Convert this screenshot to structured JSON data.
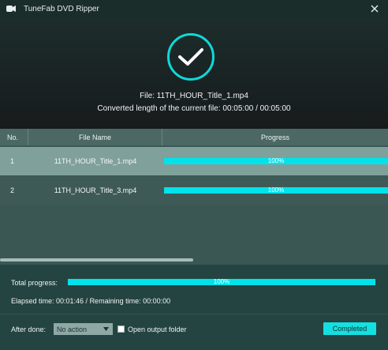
{
  "window": {
    "title": "TuneFab DVD Ripper"
  },
  "header": {
    "file_line": "File: 11TH_HOUR_Title_1.mp4",
    "converted_line": "Converted length of the current file: 00:05:00 / 00:05:00"
  },
  "table": {
    "columns": {
      "no": "No.",
      "file_name": "File Name",
      "progress": "Progress"
    },
    "rows": [
      {
        "no": "1",
        "file_name": "11TH_HOUR_Title_1.mp4",
        "progress_label": "100%",
        "progress_value": 1.0
      },
      {
        "no": "2",
        "file_name": "11TH_HOUR_Title_3.mp4",
        "progress_label": "100%",
        "progress_value": 1.0
      }
    ]
  },
  "footer": {
    "total_label": "Total progress:",
    "total_progress_label": "100%",
    "total_progress_value": 1.0,
    "elapsed": "Elapsed time: 00:01:46 / Remaining time: 00:00:00",
    "after_done_label": "After done:",
    "after_done_value": "No action",
    "open_folder_label": "Open output folder",
    "open_folder_checked": false,
    "completed_button": "Completed"
  },
  "colors": {
    "accent": "#00e3ea",
    "button": "#14e0e2",
    "selected_row": "#80a09c"
  },
  "icons": {
    "app": "app-logo-icon",
    "close": "close-icon",
    "check": "checkmark-icon",
    "dropdown": "chevron-down-icon"
  }
}
